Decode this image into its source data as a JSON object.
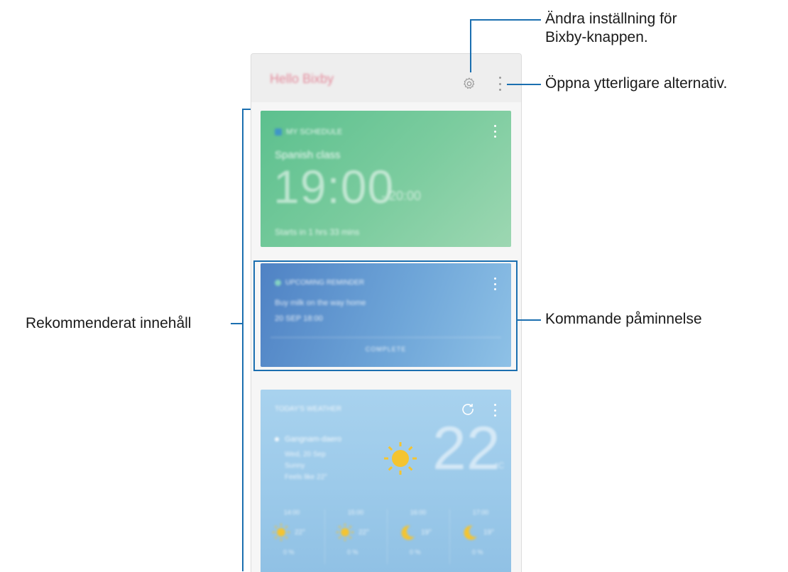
{
  "app": {
    "title": "Hello Bixby",
    "actions": {
      "settings_icon": "gear-icon",
      "more_icon": "more-vertical-icon"
    }
  },
  "cards": {
    "schedule": {
      "header": "MY SCHEDULE",
      "event": "Spanish class",
      "start_time": "19:00",
      "end_time": "- 20:00",
      "starts_in": "Starts in 1 hrs 33 mins",
      "color": "#6cc596"
    },
    "reminder": {
      "header": "UPCOMING REMINDER",
      "description": "Buy milk on the way home",
      "date": "20 SEP 18:00",
      "action": "COMPLETE",
      "color": "#5e93cf"
    },
    "weather": {
      "header": "TODAY'S WEATHER",
      "location": "Gangnam-daero",
      "date_line": "Wed, 20 Sep",
      "condition": "Sunny",
      "feels_like": "Feels like 22°",
      "temperature": "22",
      "unit": "°C",
      "color": "#a0cdeb",
      "hourly": [
        {
          "time": "14:00",
          "temp": "22°",
          "precip": "0 %",
          "icon": "sun-icon"
        },
        {
          "time": "15:00",
          "temp": "22°",
          "precip": "0 %",
          "icon": "sun-icon"
        },
        {
          "time": "16:00",
          "temp": "19°",
          "precip": "0 %",
          "icon": "moon-icon"
        },
        {
          "time": "17:00",
          "temp": "19°",
          "precip": "0 %",
          "icon": "moon-icon"
        }
      ]
    }
  },
  "annotations": {
    "settings_line1": "Ändra inställning för",
    "settings_line2": "Bixby-knappen.",
    "more_options": "Öppna ytterligare alternativ.",
    "recommended": "Rekommenderat innehåll",
    "reminder": "Kommande påminnelse",
    "accent_color": "#1b6fb0"
  }
}
